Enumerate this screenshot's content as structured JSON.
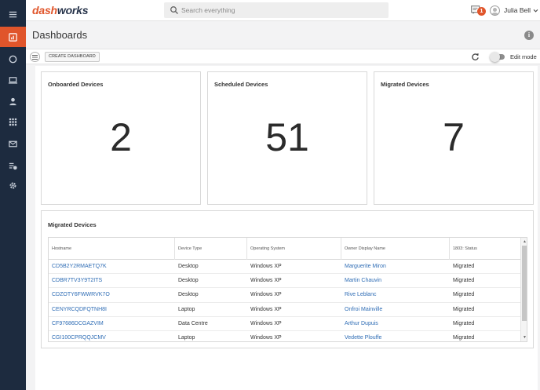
{
  "app": {
    "logo_part1": "dash",
    "logo_part2": "works"
  },
  "nav": {
    "items": [
      {
        "icon": "menu-icon"
      },
      {
        "icon": "dashboard-icon",
        "active": true
      },
      {
        "icon": "circle-icon"
      },
      {
        "icon": "laptop-icon"
      },
      {
        "icon": "user-icon"
      },
      {
        "icon": "apps-grid-icon"
      },
      {
        "icon": "mail-icon"
      },
      {
        "icon": "checklist-icon"
      },
      {
        "icon": "gear-icon"
      }
    ]
  },
  "header": {
    "search_placeholder": "Search everything",
    "notifications_count": "1",
    "user_name": "Julia Bell"
  },
  "page": {
    "title": "Dashboards"
  },
  "toolbar": {
    "create_label": "CREATE DASHBOARD",
    "edit_mode_label": "Edit mode"
  },
  "cards": [
    {
      "title": "Onboarded Devices",
      "value": "2"
    },
    {
      "title": "Scheduled Devices",
      "value": "51"
    },
    {
      "title": "Migrated Devices",
      "value": "7"
    }
  ],
  "table": {
    "title": "Migrated Devices",
    "columns": [
      "Hostname",
      "Device Type",
      "Operating System",
      "Owner Display Name",
      "1803: Status"
    ],
    "rows": [
      [
        "CD5B2Y2RMAETQ7K",
        "Desktop",
        "Windows XP",
        "Marguerite Miron",
        "Migrated"
      ],
      [
        "CDBR7TV3Y9T2ITS",
        "Desktop",
        "Windows XP",
        "Martin Chauvin",
        "Migrated"
      ],
      [
        "CDZOTY6FWWRVK7O",
        "Desktop",
        "Windows XP",
        "Rive Leblanc",
        "Migrated"
      ],
      [
        "CENYRCQDFQTNH8I",
        "Laptop",
        "Windows XP",
        "Onfroi Mainville",
        "Migrated"
      ],
      [
        "CF97686DCGAZVIM",
        "Data Centre",
        "Windows XP",
        "Arthur Dupuis",
        "Migrated"
      ],
      [
        "CGI100CPRQQJCMV",
        "Laptop",
        "Windows XP",
        "Vedette Plouffe",
        "Migrated"
      ]
    ]
  },
  "colors": {
    "accent": "#e0552b",
    "nav_bg": "#1d2b3f",
    "link": "#2f6db5"
  }
}
